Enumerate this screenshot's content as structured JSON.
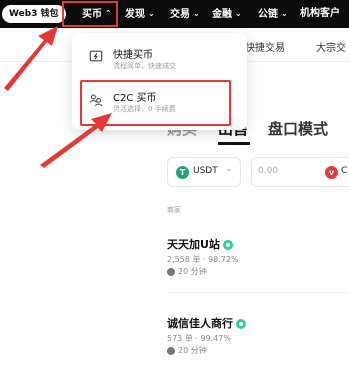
{
  "nav": {
    "web3": "Web3 钱包",
    "buy": "买币",
    "discover": "发现",
    "trade": "交易",
    "finance": "金融",
    "chain": "公链",
    "institution": "机构客户"
  },
  "subnav": {
    "quick": "快捷交易",
    "bulk": "大宗交"
  },
  "dropdown": {
    "item1_title": "快捷买币",
    "item1_desc": "流程简单，快速成交",
    "item2_title": "C2C 买币",
    "item2_desc": "灵活选择，0 手续费"
  },
  "trade_tabs": {
    "left": "购买",
    "active": "出售",
    "book": "盘口模式"
  },
  "inputs": {
    "coin": "USDT",
    "amount_placeholder": "0.00",
    "fiat_partial": "C"
  },
  "merchant_header": "商家",
  "merchants": [
    {
      "name": "天天加U站",
      "stats": "2,558 单 · 98.72%",
      "time": "20 分钟"
    },
    {
      "name": "诚信佳人商行",
      "stats": "573 单 · 99.47%",
      "time": "20 分钟"
    }
  ],
  "colors": {
    "highlight": "#e53935",
    "nav_bg": "#0b0b0b",
    "usdt": "#26a17b"
  }
}
